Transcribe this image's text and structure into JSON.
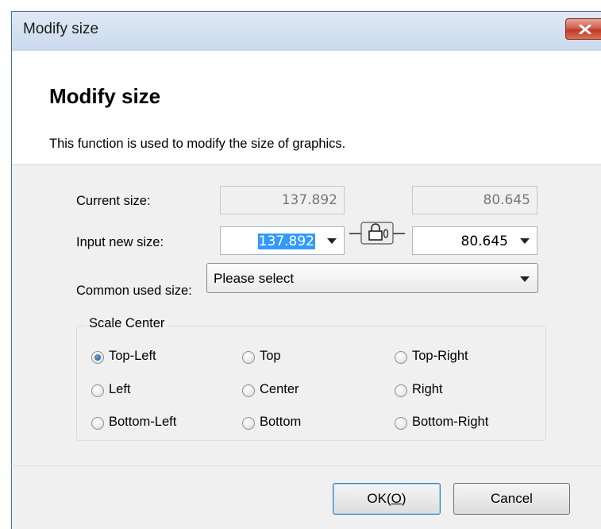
{
  "window": {
    "title": "Modify size",
    "close_icon": "close-icon"
  },
  "header": {
    "heading": "Modify size",
    "description": "This function is used to modify the size of graphics."
  },
  "current_size": {
    "label": "Current size:",
    "width": "137.892",
    "height": "80.645"
  },
  "new_size": {
    "label": "Input new size:",
    "width": "137.892",
    "height": "80.645",
    "lock_icon": "chain-lock-icon"
  },
  "common_size": {
    "label": "Common used size:",
    "value": "Please select"
  },
  "scale_center": {
    "title": "Scale Center",
    "selected": "Top-Left",
    "options": [
      "Top-Left",
      "Top",
      "Top-Right",
      "Left",
      "Center",
      "Right",
      "Bottom-Left",
      "Bottom",
      "Bottom-Right"
    ]
  },
  "buttons": {
    "ok": "OK(O)",
    "ok_mnemonic": "O",
    "cancel": "Cancel"
  },
  "colors": {
    "selection": "#3399ff",
    "close_button": "#c0392b",
    "titlebar": "#c9d9ec"
  }
}
